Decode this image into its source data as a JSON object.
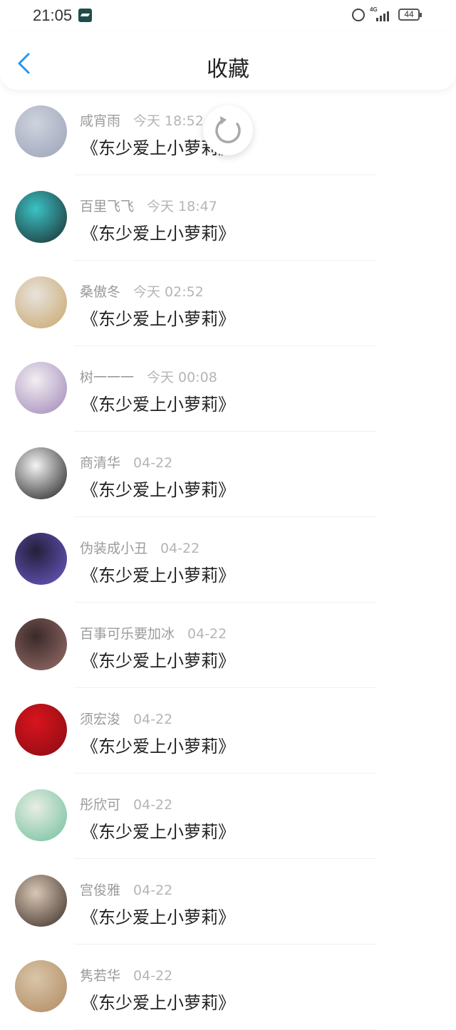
{
  "status_bar": {
    "time": "21:05",
    "network": "4G",
    "battery": "44"
  },
  "header": {
    "title": "收藏",
    "back_icon": "chevron-left-icon"
  },
  "refresh_icon": "refresh-spinner-icon",
  "accent_color": "#2196f3",
  "items": [
    {
      "name": "咸宵雨",
      "time": "今天 18:52",
      "title": "《东少爱上小萝莉》",
      "avatar_colors": [
        "#cfd3de",
        "#9aa2b8"
      ]
    },
    {
      "name": "百里飞飞",
      "time": "今天 18:47",
      "title": "《东少爱上小萝莉》",
      "avatar_colors": [
        "#3bc3c4",
        "#1b2a2e"
      ]
    },
    {
      "name": "桑傲冬",
      "time": "今天 02:52",
      "title": "《东少爱上小萝莉》",
      "avatar_colors": [
        "#e7e3dc",
        "#c9a56a"
      ]
    },
    {
      "name": "树一一一",
      "time": "今天 00:08",
      "title": "《东少爱上小萝莉》",
      "avatar_colors": [
        "#f2eef2",
        "#9f86b6"
      ]
    },
    {
      "name": "商清华",
      "time": "04-22",
      "title": "《东少爱上小萝莉》",
      "avatar_colors": [
        "#f4f4f4",
        "#1c1c1c"
      ]
    },
    {
      "name": "伪装成小丑",
      "time": "04-22",
      "title": "《东少爱上小萝莉》",
      "avatar_colors": [
        "#24203a",
        "#6b5ac9"
      ]
    },
    {
      "name": "百事可乐要加冰",
      "time": "04-22",
      "title": "《东少爱上小萝莉》",
      "avatar_colors": [
        "#3a2a2a",
        "#9a6f6a"
      ]
    },
    {
      "name": "须宏浚",
      "time": "04-22",
      "title": "《东少爱上小萝莉》",
      "avatar_colors": [
        "#d8141e",
        "#8a0c12"
      ]
    },
    {
      "name": "彤欣可",
      "time": "04-22",
      "title": "《东少爱上小萝莉》",
      "avatar_colors": [
        "#e8ede3",
        "#6fbf9d"
      ]
    },
    {
      "name": "宫俊雅",
      "time": "04-22",
      "title": "《东少爱上小萝莉》",
      "avatar_colors": [
        "#d9c7b5",
        "#3a2c25"
      ]
    },
    {
      "name": "隽若华",
      "time": "04-22",
      "title": "《东少爱上小萝莉》",
      "avatar_colors": [
        "#d9c5a8",
        "#b08a62"
      ]
    }
  ]
}
